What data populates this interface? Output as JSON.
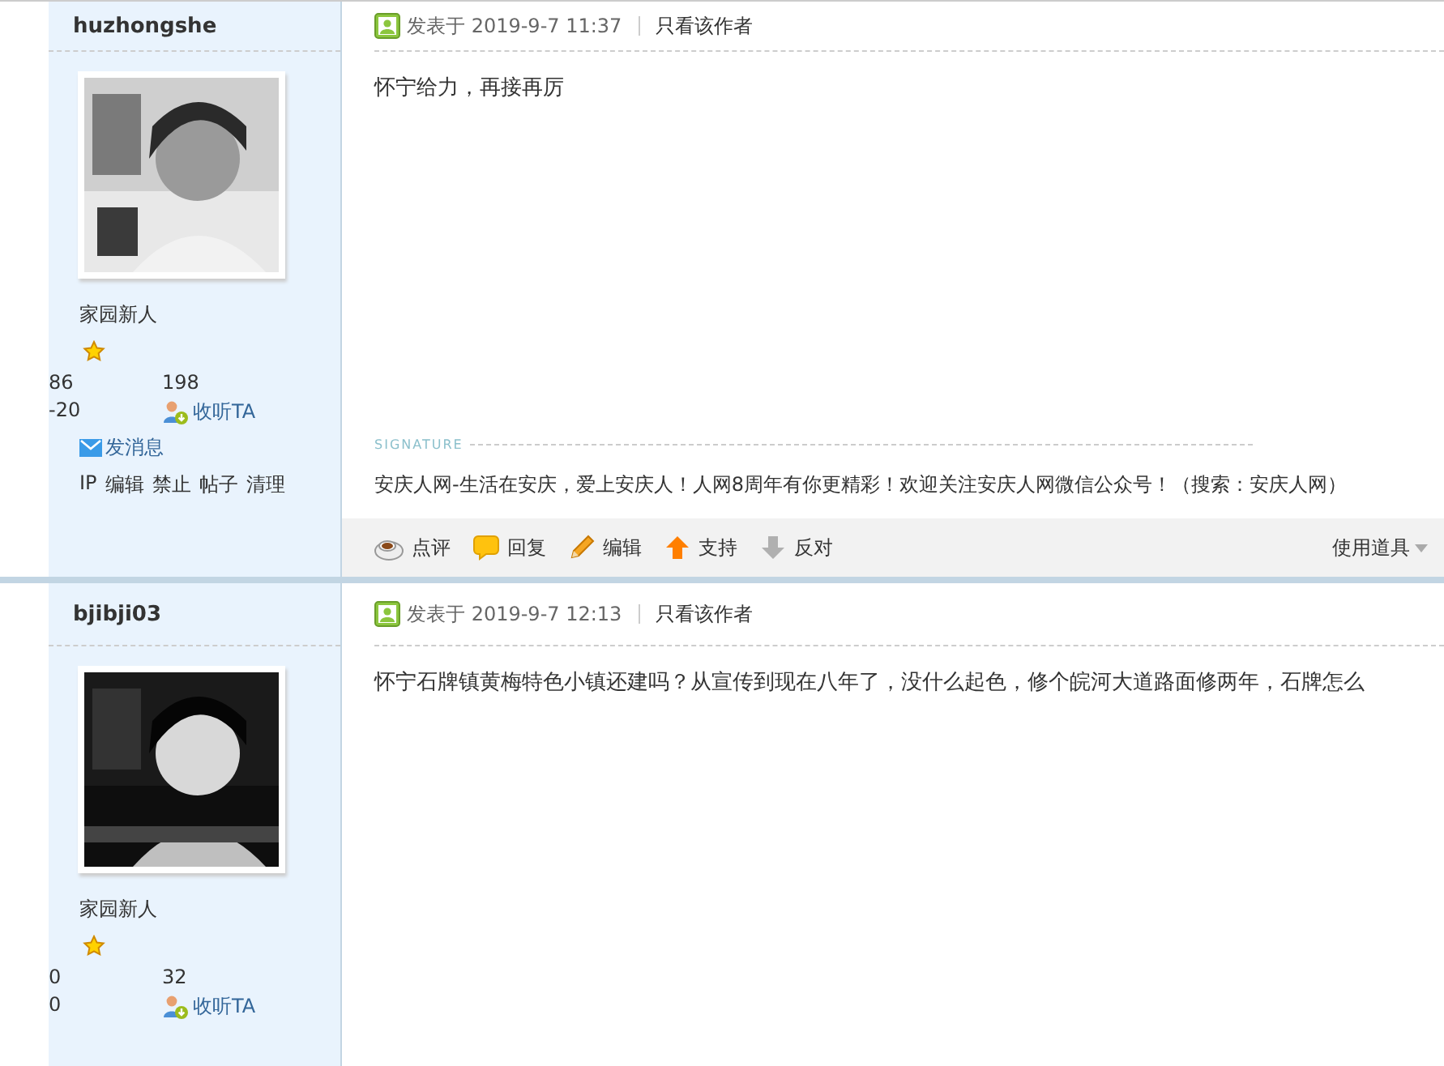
{
  "posts": [
    {
      "author": "huzhongshe",
      "rank": "家园新人",
      "stats": [
        "86",
        "198",
        "-20"
      ],
      "follow": "收听TA",
      "message": "发消息",
      "admin_links": [
        "IP",
        "编辑",
        "禁止",
        "帖子",
        "清理"
      ],
      "posted": "发表于 2019-9-7 11:37",
      "author_only": "只看该作者",
      "body": "怀宁给力，再接再厉",
      "signature_label": "SIGNATURE",
      "signature": "安庆人网-生活在安庆，爱上安庆人！人网8周年有你更精彩！欢迎关注安庆人网微信公众号！（搜索：安庆人网）",
      "actions": [
        {
          "kind": "comment",
          "label": "点评"
        },
        {
          "kind": "reply",
          "label": "回复"
        },
        {
          "kind": "edit",
          "label": "编辑"
        },
        {
          "kind": "support",
          "label": "支持"
        },
        {
          "kind": "oppose",
          "label": "反对"
        }
      ],
      "tools": "使用道具"
    },
    {
      "author": "bjibji03",
      "rank": "家园新人",
      "stats": [
        "0",
        "32",
        "0"
      ],
      "follow": "收听TA",
      "posted": "发表于 2019-9-7 12:13",
      "author_only": "只看该作者",
      "body": "怀宁石牌镇黄梅特色小镇还建吗？从宣传到现在八年了，没什么起色，修个皖河大道路面修两年，石牌怎么"
    }
  ]
}
